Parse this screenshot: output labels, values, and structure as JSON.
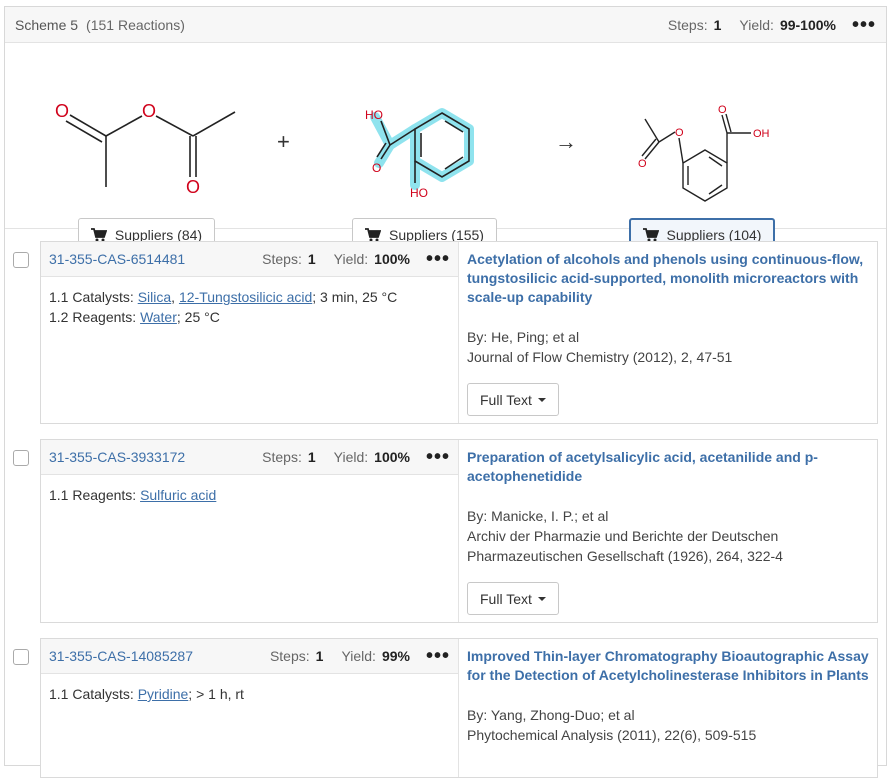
{
  "scheme": {
    "title": "Scheme 5",
    "count": "(151 Reactions)",
    "steps_label": "Steps:",
    "steps_value": "1",
    "yield_label": "Yield:",
    "yield_value": "99-100%",
    "more": "•••"
  },
  "structures": {
    "plus": "+",
    "arrow": "→",
    "suppliers": [
      {
        "label": "Suppliers (84)"
      },
      {
        "label": "Suppliers (155)"
      },
      {
        "label": "Suppliers (104)"
      }
    ],
    "atoms": {
      "o": "O",
      "ho": "HO",
      "oh": "OH"
    }
  },
  "results": [
    {
      "id": "31-355-CAS-6514481",
      "steps_label": "Steps:",
      "steps": "1",
      "yield_label": "Yield:",
      "yield": "100%",
      "more": "•••",
      "line1_prefix": "1.1  Catalysts: ",
      "line1_link1": "Silica",
      "line1_sep": ", ",
      "line1_link2": "12-Tungstosilicic acid",
      "line1_suffix": ";  3 min, 25 °C",
      "line2_prefix": "1.2  Reagents: ",
      "line2_link1": "Water",
      "line2_suffix": ";  25 °C",
      "title": "Acetylation of alcohols and phenols using continuous-flow, tungstosilicic acid-supported, monolith microreactors with scale-up capability",
      "author": "By: He, Ping; et al",
      "journal": "Journal of Flow Chemistry (2012), 2, 47-51",
      "fulltext": "Full Text"
    },
    {
      "id": "31-355-CAS-3933172",
      "steps_label": "Steps:",
      "steps": "1",
      "yield_label": "Yield:",
      "yield": "100%",
      "more": "•••",
      "line1_prefix": "1.1  Reagents: ",
      "line1_link1": "Sulfuric acid",
      "title": "Preparation of acetylsalicylic acid, acetanilide and p-acetophenetidide",
      "author": "By: Manicke, I. P.; et al",
      "journal": "Archiv der Pharmazie und Berichte der Deutschen Pharmazeutischen Gesellschaft (1926), 264, 322-4",
      "fulltext": "Full Text"
    },
    {
      "id": "31-355-CAS-14085287",
      "steps_label": "Steps:",
      "steps": "1",
      "yield_label": "Yield:",
      "yield": "99%",
      "more": "•••",
      "line1_prefix": "1.1  Catalysts: ",
      "line1_link1": "Pyridine",
      "line1_suffix": ";  > 1 h, rt",
      "title": "Improved Thin-layer Chromatography Bioautographic Assay for the Detection of Acetylcholinesterase Inhibitors in Plants",
      "author": "By: Yang, Zhong-Duo; et al",
      "journal": "Phytochemical Analysis (2011), 22(6), 509-515"
    }
  ]
}
